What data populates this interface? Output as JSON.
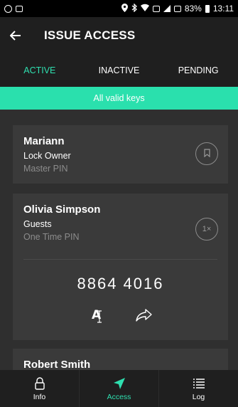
{
  "statusbar": {
    "battery": "83%",
    "time": "13:11"
  },
  "header": {
    "title": "ISSUE ACCESS",
    "back_icon": "back-arrow-icon"
  },
  "tabs": [
    {
      "label": "ACTIVE",
      "active": true
    },
    {
      "label": "INACTIVE",
      "active": false
    },
    {
      "label": "PENDING",
      "active": false
    }
  ],
  "banner": {
    "text": "All valid keys"
  },
  "cards": [
    {
      "name": "Mariann",
      "role": "Lock Owner",
      "pin_type": "Master PIN",
      "icon": "bookmark-icon"
    },
    {
      "name": "Olivia Simpson",
      "role": "Guests",
      "pin_type": "One Time PIN",
      "badge": "1×",
      "code": "8864 4016"
    },
    {
      "name": "Robert Smith"
    }
  ],
  "bottom_nav": [
    {
      "label": "Info",
      "icon": "lock-icon",
      "active": false
    },
    {
      "label": "Access",
      "icon": "send-icon",
      "active": true
    },
    {
      "label": "Log",
      "icon": "list-icon",
      "active": false
    }
  ],
  "colors": {
    "accent": "#2ae0ad",
    "background": "#2f2f2f",
    "card": "#3a3a3a",
    "bar": "#1f1f1f"
  }
}
